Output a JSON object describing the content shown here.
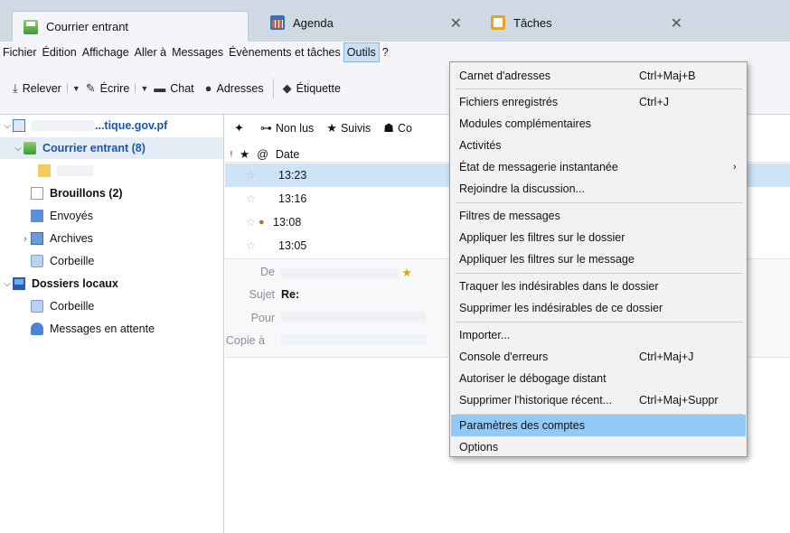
{
  "tabs": [
    {
      "label": "Courrier entrant",
      "icon": "inbox-icon"
    },
    {
      "label": "Agenda",
      "icon": "calendar-icon"
    },
    {
      "label": "Tâches",
      "icon": "tasks-icon"
    }
  ],
  "menubar": [
    "Fichier",
    "Édition",
    "Affichage",
    "Aller à",
    "Messages",
    "Évènements et tâches",
    "Outils",
    "?"
  ],
  "toolbar": {
    "relever": "Relever",
    "ecrire": "Écrire",
    "chat": "Chat",
    "adresses": "Adresses",
    "etiquette": "Étiquette"
  },
  "folders": {
    "account": "...tique.gov.pf",
    "inbox": "Courrier entrant (8)",
    "drafts": "Brouillons (2)",
    "sent": "Envoyés",
    "archives": "Archives",
    "trash": "Corbeille",
    "local": "Dossiers locaux",
    "local_trash": "Corbeille",
    "outbox": "Messages en attente"
  },
  "quickfilter": {
    "unread": "Non lus",
    "starred": "Suivis",
    "contact": "Co"
  },
  "thread_header": {
    "date": "Date"
  },
  "messages": [
    {
      "time": "13:23"
    },
    {
      "time": "13:16"
    },
    {
      "time": "13:08"
    },
    {
      "time": "13:05"
    }
  ],
  "message_header": {
    "from_label": "De",
    "subject_label": "Sujet",
    "subject_value": "Re:",
    "to_label": "Pour",
    "cc_label": "Copie à"
  },
  "outils_menu": {
    "items": [
      {
        "label": "Carnet d'adresses",
        "shortcut": "Ctrl+Maj+B"
      },
      {
        "label": "Fichiers enregistrés",
        "shortcut": "Ctrl+J"
      },
      {
        "label": "Modules complémentaires",
        "shortcut": ""
      },
      {
        "label": "Activités",
        "shortcut": ""
      },
      {
        "label": "État de messagerie instantanée",
        "shortcut": ""
      },
      {
        "label": "Rejoindre la discussion...",
        "shortcut": ""
      },
      {
        "label": "Filtres de messages",
        "shortcut": ""
      },
      {
        "label": "Appliquer les filtres sur le dossier",
        "shortcut": ""
      },
      {
        "label": "Appliquer les filtres sur le message",
        "shortcut": ""
      },
      {
        "label": "Traquer les indésirables dans le dossier",
        "shortcut": ""
      },
      {
        "label": "Supprimer les indésirables de ce dossier",
        "shortcut": ""
      },
      {
        "label": "Importer...",
        "shortcut": ""
      },
      {
        "label": "Console d'erreurs",
        "shortcut": "Ctrl+Maj+J"
      },
      {
        "label": "Autoriser le débogage distant",
        "shortcut": ""
      },
      {
        "label": "Supprimer l'historique récent...",
        "shortcut": "Ctrl+Maj+Suppr"
      },
      {
        "label": "Paramètres des comptes",
        "shortcut": ""
      },
      {
        "label": "Options",
        "shortcut": ""
      }
    ]
  },
  "colors": {
    "highlight": "#91c9f7",
    "selected_row": "#cfe3f7",
    "menubar_open": "#cbe0f4"
  }
}
